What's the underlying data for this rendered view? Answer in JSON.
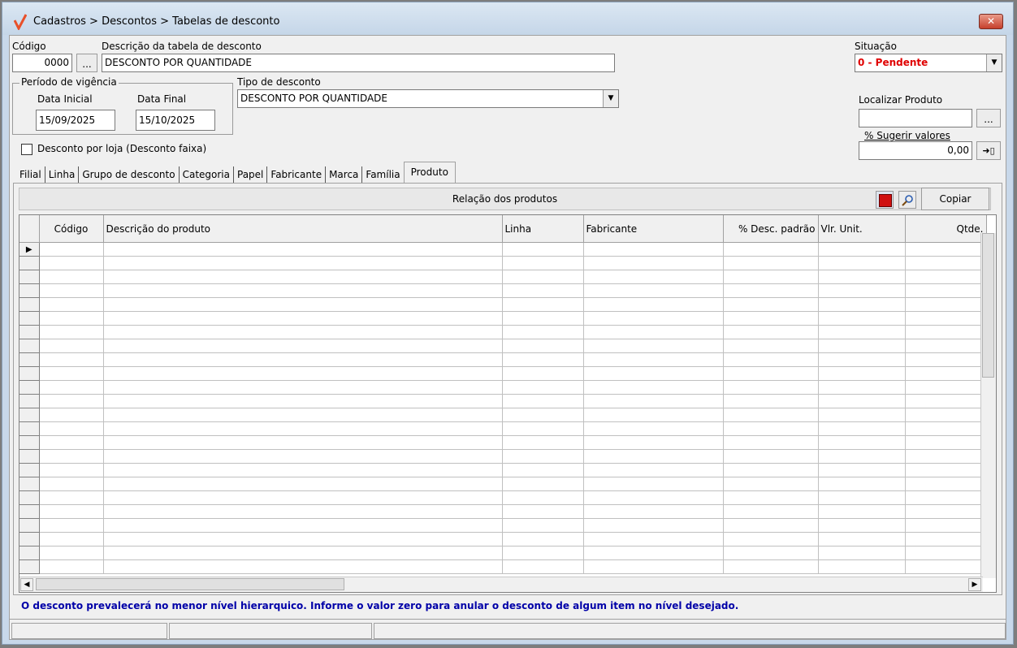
{
  "window": {
    "title": "Cadastros > Descontos > Tabelas de desconto",
    "close": "✕"
  },
  "form": {
    "codigo_label": "Código",
    "codigo_value": "0000",
    "browse_label": "...",
    "descricao_label": "Descrição da tabela de desconto",
    "descricao_value": "DESCONTO POR QUANTIDADE",
    "situacao_label": "Situação",
    "situacao_value": "0 - Pendente",
    "periodo_label": "Período de vigência",
    "data_inicial_label": "Data Inicial",
    "data_inicial_value": "15/09/2025",
    "data_final_label": "Data Final",
    "data_final_value": "15/10/2025",
    "tipo_label": "Tipo de desconto",
    "tipo_value": "DESCONTO POR QUANTIDADE",
    "localizar_label": "Localizar Produto",
    "localizar_value": "",
    "sugerir_label": "% Sugerir valores",
    "sugerir_value": "0,00",
    "apply_icon_glyph": "➜▯",
    "desconto_loja_label": "Desconto por loja (Desconto faixa)",
    "desconto_loja_checked": false
  },
  "tabs": [
    "Filial",
    "Linha",
    "Grupo de desconto",
    "Categoria",
    "Papel",
    "Fabricante",
    "Marca",
    "Família",
    "Produto"
  ],
  "active_tab": "Produto",
  "panel": {
    "title": "Relação dos produtos",
    "copy_label": "Copiar"
  },
  "grid": {
    "columns": [
      "Código",
      "Descrição do produto",
      "Linha",
      "Fabricante",
      "% Desc. padrão",
      "Vlr. Unit.",
      "Qtde."
    ],
    "row_count": 24,
    "current_row_marker": "▶"
  },
  "info_text": "O desconto prevalecerá no menor nível hierarquico. Informe o valor zero para anular o desconto de algum item no nível desejado.",
  "colors": {
    "situacao": "#e00000",
    "info": "#0000a8",
    "title_bar": "#c8d8ea",
    "close_button": "#c6402c"
  }
}
